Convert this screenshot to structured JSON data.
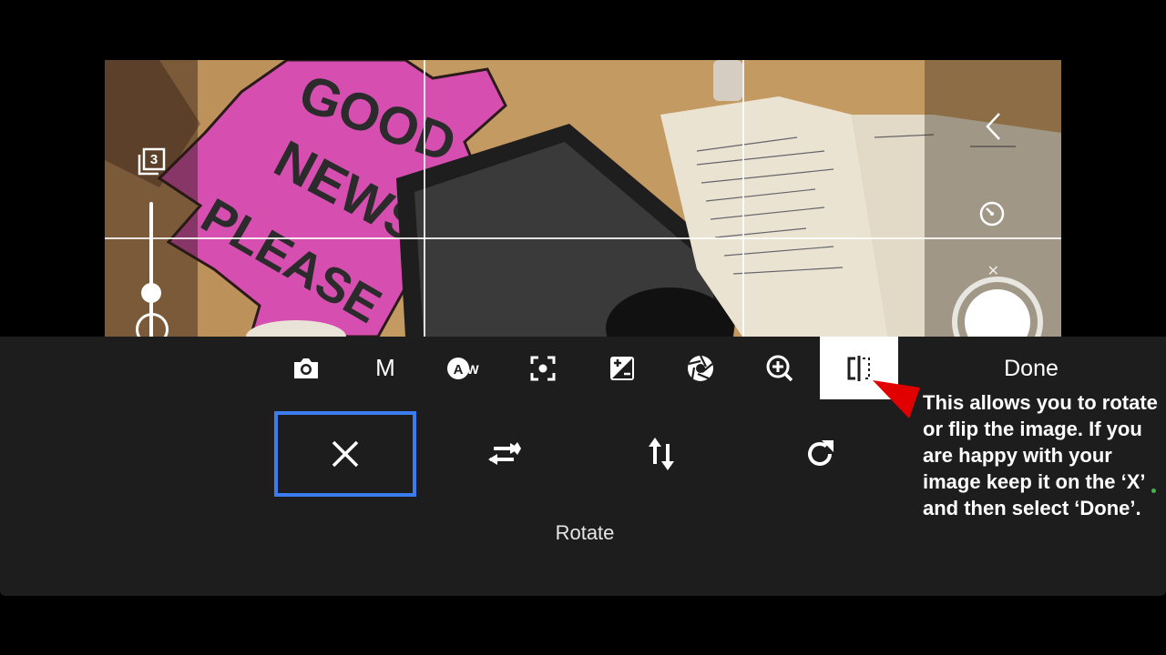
{
  "preview": {
    "gallery_count": "3",
    "sign_text": [
      "GOOD",
      "NEWS",
      "PLEASE"
    ]
  },
  "toolbar": {
    "items": [
      {
        "icon": "camera-icon"
      },
      {
        "label": "M"
      },
      {
        "icon": "auto-white-balance-icon"
      },
      {
        "icon": "focus-icon"
      },
      {
        "icon": "exposure-icon"
      },
      {
        "icon": "aperture-icon"
      },
      {
        "icon": "zoom-in-icon"
      },
      {
        "icon": "flip-icon",
        "active": true
      }
    ],
    "done_label": "Done"
  },
  "options": {
    "items": [
      {
        "icon": "close-icon",
        "selected": true
      },
      {
        "icon": "flip-horizontal-icon"
      },
      {
        "icon": "flip-vertical-icon"
      },
      {
        "icon": "rotate-icon"
      }
    ],
    "label": "Rotate"
  },
  "annotation": {
    "text": "This allows you to rotate or flip the image. If you are happy with your image keep it on the ‘X’ and then select ‘Done’.",
    "arrow_color": "#e00000"
  },
  "colors": {
    "panel": "#1d1d1d",
    "selected_border": "#3b7cf0",
    "sign": "#d64fb0"
  }
}
